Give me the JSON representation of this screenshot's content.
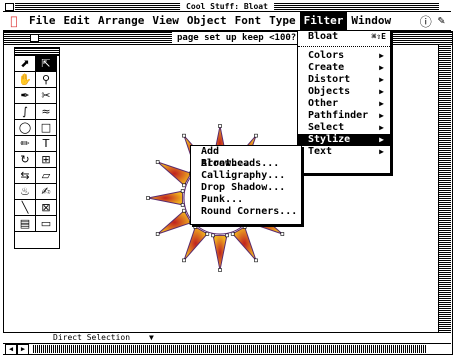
{
  "window": {
    "title": "Cool Stuff: Bloat"
  },
  "menubar": {
    "items": [
      "File",
      "Edit",
      "Arrange",
      "View",
      "Object",
      "Font",
      "Type",
      "Filter",
      "Window"
    ],
    "active": "Filter"
  },
  "document": {
    "title": "page set up keep <100?"
  },
  "filter_menu": {
    "items": [
      {
        "label": "Bloat",
        "shortcut": "⌘⇧E"
      },
      {
        "label": "Colors",
        "submenu": true
      },
      {
        "label": "Create",
        "submenu": true
      },
      {
        "label": "Distort",
        "submenu": true
      },
      {
        "label": "Objects",
        "submenu": true
      },
      {
        "label": "Other",
        "submenu": true
      },
      {
        "label": "Pathfinder",
        "submenu": true
      },
      {
        "label": "Select",
        "submenu": true
      },
      {
        "label": "Stylize",
        "submenu": true
      },
      {
        "label": "Text",
        "submenu": true
      }
    ]
  },
  "stylize_submenu": {
    "items": [
      "Add Arrowheads...",
      "Bloat...",
      "Calligraphy...",
      "Drop Shadow...",
      "Punk...",
      "Round Corners..."
    ]
  },
  "status": {
    "tool": "Direct Selection"
  },
  "colors": {
    "sun_core": "#5a2a6e",
    "ray_inner": "#c02020",
    "ray_outer": "#f0b020"
  }
}
